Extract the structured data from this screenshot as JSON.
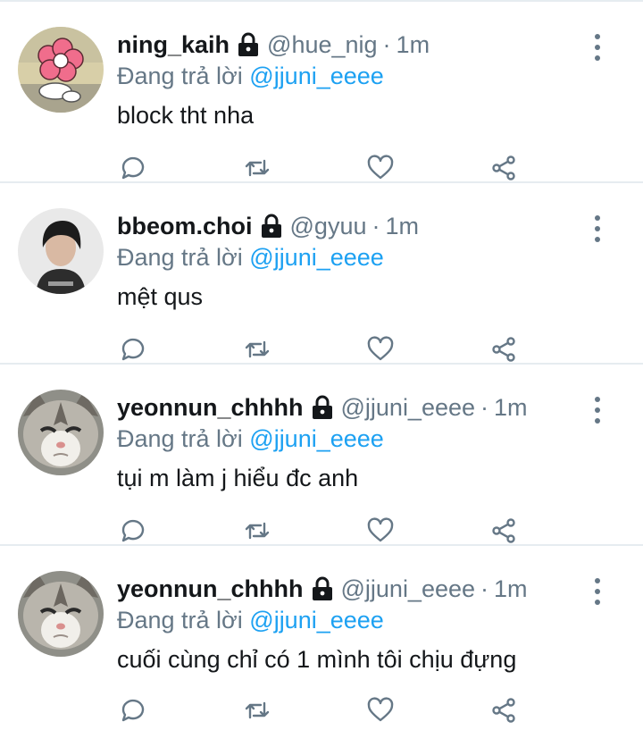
{
  "reply_prefix": "Đang trả lời",
  "separator": "·",
  "tweets": [
    {
      "display_name": "ning_kaih",
      "handle": "@hue_nig",
      "time": "1m",
      "reply_to": "@jjuni_eeee",
      "text": "block tht nha",
      "avatar_icon": "pink-flower-cartoon-avatar",
      "locked": true
    },
    {
      "display_name": "bbeom.choi",
      "handle": "@gyuu",
      "time": "1m",
      "reply_to": "@jjuni_eeee",
      "text": "mệt qus",
      "avatar_icon": "person-photo-avatar",
      "locked": true
    },
    {
      "display_name": "yeonnun_chhhh",
      "handle": "@jjuni_eeee",
      "time": "1m",
      "reply_to": "@jjuni_eeee",
      "text": "tụi m làm j hiểu đc anh",
      "avatar_icon": "grumpy-cat-avatar",
      "locked": true
    },
    {
      "display_name": "yeonnun_chhhh",
      "handle": "@jjuni_eeee",
      "time": "1m",
      "reply_to": "@jjuni_eeee",
      "text": "cuối cùng chỉ có 1 mình tôi chịu đựng",
      "avatar_icon": "grumpy-cat-avatar",
      "locked": true
    }
  ],
  "actions": [
    "reply-icon",
    "retweet-icon",
    "like-icon",
    "share-icon"
  ],
  "colors": {
    "link": "#1da1f2",
    "muted": "#657786",
    "text": "#14171a",
    "divider": "#e6ecf0"
  }
}
